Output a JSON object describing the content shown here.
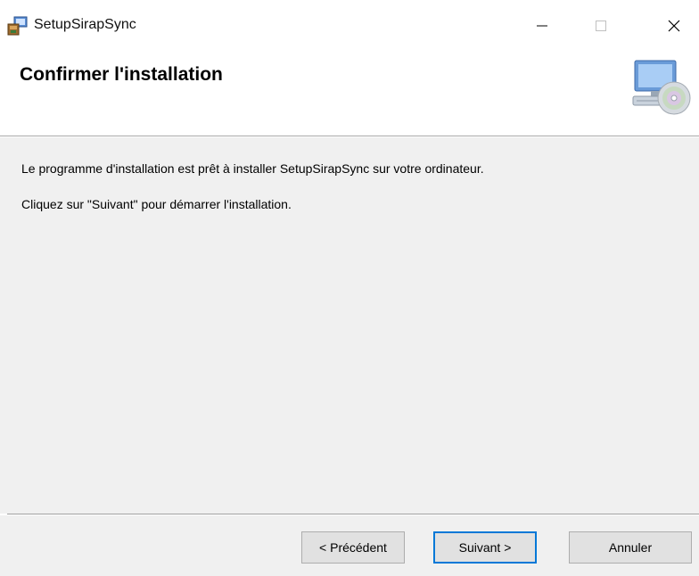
{
  "window": {
    "title": "SetupSirapSync",
    "minimize_icon": "minimize-icon",
    "maximize_icon": "maximize-icon",
    "close_icon": "close-icon"
  },
  "header": {
    "title": "Confirmer l'installation",
    "icon": "computer-cd-icon"
  },
  "content": {
    "line1": "Le programme d'installation est prêt à installer SetupSirapSync sur votre ordinateur.",
    "line2": "Cliquez sur \"Suivant\" pour démarrer l'installation."
  },
  "buttons": {
    "previous": "< Précédent",
    "next": "Suivant >",
    "cancel": "Annuler"
  },
  "colors": {
    "content_bg": "#f0f0f0",
    "button_bg": "#e1e1e1",
    "default_button_border": "#0078d7"
  }
}
